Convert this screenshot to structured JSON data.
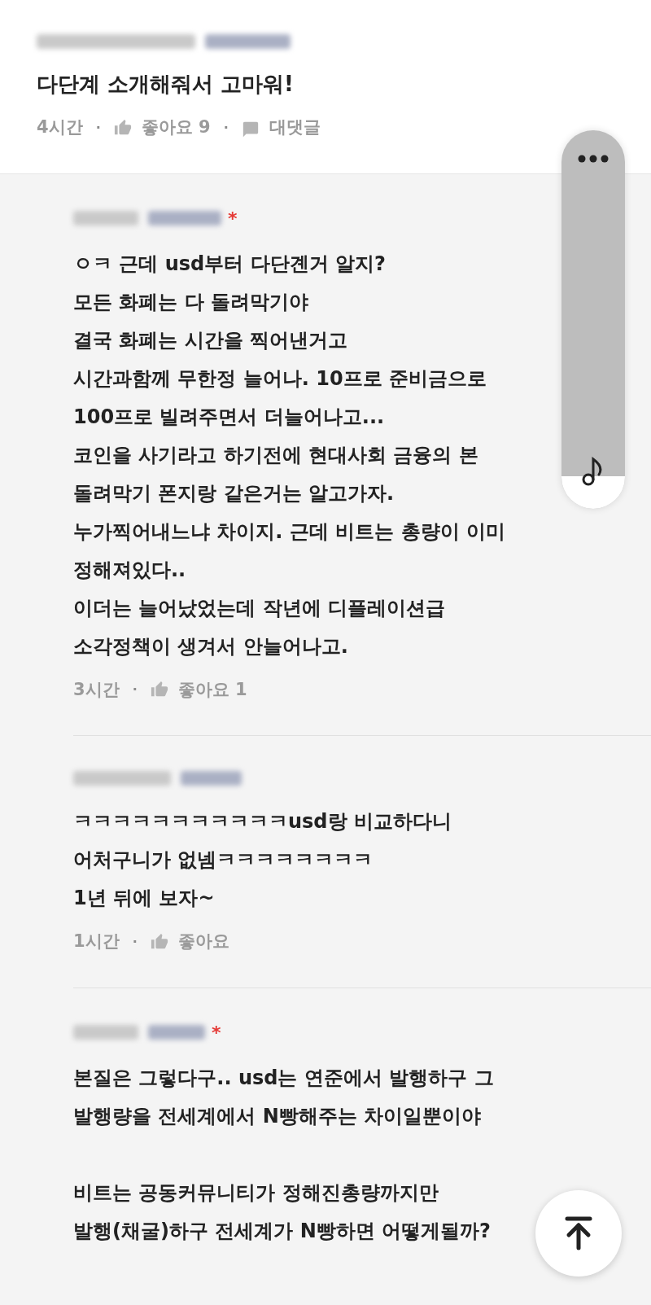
{
  "separator": "·",
  "post_comment": {
    "text": "다단계 소개해줘서 고마워!",
    "time": "4시간",
    "like_label": "좋아요 9",
    "reply_label": "대댓글"
  },
  "replies": [
    {
      "badge": "*",
      "text": "ㅇㅋ 근데 usd부터 다단곈거 알지?\n모든 화폐는 다 돌려막기야\n결국 화폐는 시간을 찍어낸거고\n시간과함께 무한정 늘어나. 10프로 준비금으로\n100프로 빌려주면서 더늘어나고...\n코인을 사기라고 하기전에 현대사회 금융의 본\n돌려막기 폰지랑 같은거는 알고가자.\n누가찍어내느냐 차이지. 근데 비트는 총량이 이미\n정해져있다..\n이더는 늘어났었는데 작년에 디플레이션급\n소각정책이 생겨서 안늘어나고.",
      "time": "3시간",
      "like_label": "좋아요 1"
    },
    {
      "text": "ㅋㅋㅋㅋㅋㅋㅋㅋㅋㅋㅋusd랑 비교하다니\n어처구니가 없넴ㅋㅋㅋㅋㅋㅋㅋㅋ\n1년 뒤에  보자~",
      "time": "1시간",
      "like_label": "좋아요"
    },
    {
      "badge": "*",
      "text": "본질은 그렇다구.. usd는 연준에서 발행하구 그\n발행량을 전세계에서 N빵해주는 차이일뿐이야\n\n비트는 공동커뮤니티가 정해진총량까지만\n발행(채굴)하구 전세계가 N빵하면 어떻게될까?"
    }
  ]
}
